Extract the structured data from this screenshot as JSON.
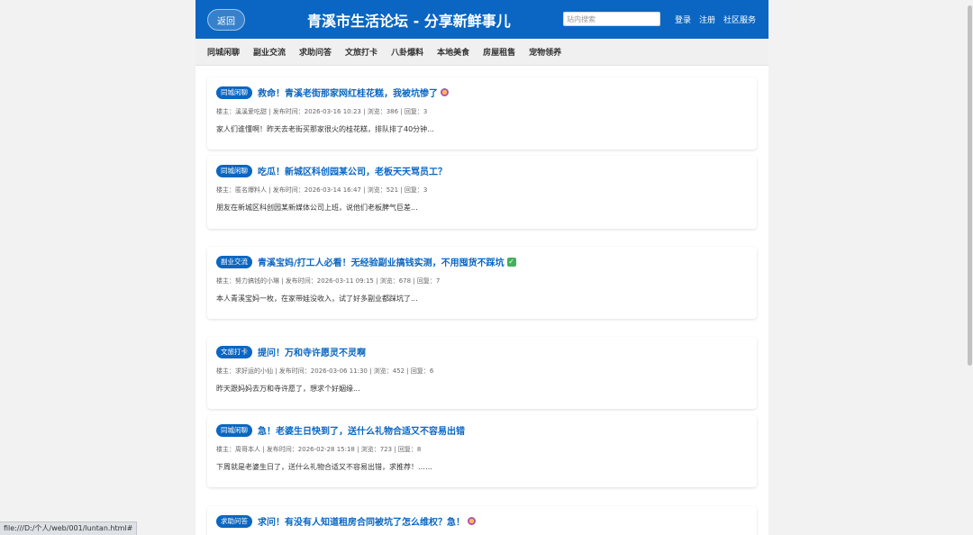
{
  "header": {
    "back_label": "返回",
    "title": "青溪市生活论坛 - 分享新鲜事儿",
    "search_placeholder": "站内搜索",
    "links": [
      "登录",
      "注册",
      "社区服务"
    ]
  },
  "categories": [
    "同城闲聊",
    "副业交流",
    "求助问答",
    "文旅打卡",
    "八卦爆料",
    "本地美食",
    "房屋租售",
    "宠物领养"
  ],
  "posts": [
    {
      "tag": "同城闲聊",
      "title": "救命！青溪老街那家网红桂花糕，我被坑惨了",
      "emoji": "face-icon",
      "meta": "楼主：溪溪爱吃甜 | 发布时间：2026-03-16 10:23 | 浏览：386 | 回复：3",
      "excerpt": "家人们谁懂啊！昨天去老街买那家很火的桂花糕，排队排了40分钟..."
    },
    {
      "tag": "同城闲聊",
      "title": "吃瓜！新城区科创园某公司，老板天天骂员工？",
      "emoji": "",
      "meta": "楼主：匿名爆料人 | 发布时间：2026-03-14 16:47 | 浏览：521 | 回复：3",
      "excerpt": "朋友在新城区科创园某新媒体公司上班，说他们老板脾气巨差..."
    },
    {
      "tag": "副业交流",
      "title": "青溪宝妈/打工人必看！无经验副业搞钱实测，不用囤货不踩坑",
      "emoji": "check-icon",
      "meta": "楼主：努力搞钱的小琳 | 发布时间：2026-03-11 09:15 | 浏览：678 | 回复：7",
      "excerpt": "本人青溪宝妈一枚，在家带娃没收入，试了好多副业都踩坑了..."
    },
    {
      "tag": "文旅打卡",
      "title": "提问！万和寺许愿灵不灵啊",
      "emoji": "",
      "meta": "楼主：求好运的小仙 | 发布时间：2026-03-06 11:30 | 浏览：452 | 回复：6",
      "excerpt": "昨天跟妈妈去万和寺许愿了，想求个好姻缘..."
    },
    {
      "tag": "同城闲聊",
      "title": "急！老婆生日快到了，送什么礼物合适又不容易出错",
      "emoji": "",
      "meta": "楼主：周哥本人 | 发布时间：2026-02-28 15:18 | 浏览：723 | 回复：8",
      "excerpt": "下周就是老婆生日了，送什么礼物合适又不容易出错，求推荐！……"
    },
    {
      "tag": "求助问答",
      "title": "求问！有没有人知道租房合同被坑了怎么维权？急！",
      "emoji": "face-icon",
      "meta": "",
      "excerpt": ""
    }
  ],
  "status_bar": "file:///D:/个人/web/001/luntan.html#",
  "colors": {
    "primary": "#0a66c2",
    "nav_bg": "#f0f0f0",
    "page_bg": "#f2f2f2"
  }
}
